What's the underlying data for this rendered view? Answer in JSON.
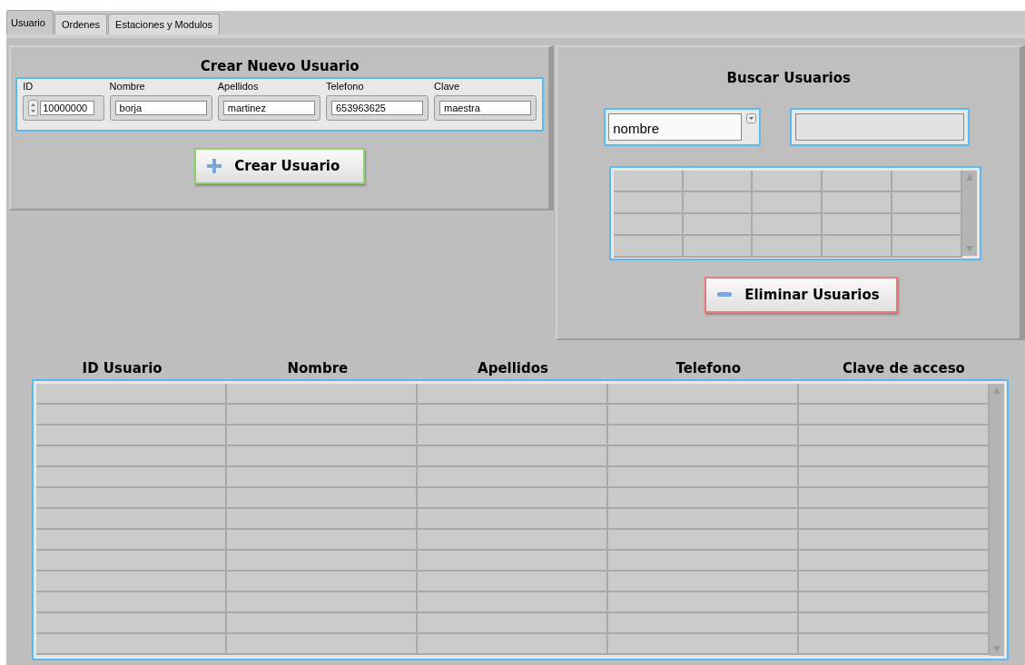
{
  "tabs": [
    {
      "label": "Usuario",
      "selected": true
    },
    {
      "label": "Ordenes",
      "selected": false
    },
    {
      "label": "Estaciones y Modulos",
      "selected": false
    }
  ],
  "create_user": {
    "title": "Crear Nuevo Usuario",
    "fields": [
      {
        "kind": "spinner",
        "label": "ID",
        "value": "10000000"
      },
      {
        "kind": "text",
        "label": "Nombre",
        "value": "borja"
      },
      {
        "kind": "text",
        "label": "Apellidos",
        "value": "martinez"
      },
      {
        "kind": "text",
        "label": "Telefono",
        "value": "653963625"
      },
      {
        "kind": "text",
        "label": "Clave",
        "value": "maestra"
      }
    ],
    "button": "Crear Usuario"
  },
  "search_users": {
    "title": "Buscar Usuarios",
    "filter": {
      "value": "nombre"
    },
    "button": "Eliminar Usuarios"
  },
  "users_table": {
    "columns": [
      "ID Usuario",
      "Nombre",
      "Apellidos",
      "Telefono",
      "Clave de acceso"
    ]
  }
}
